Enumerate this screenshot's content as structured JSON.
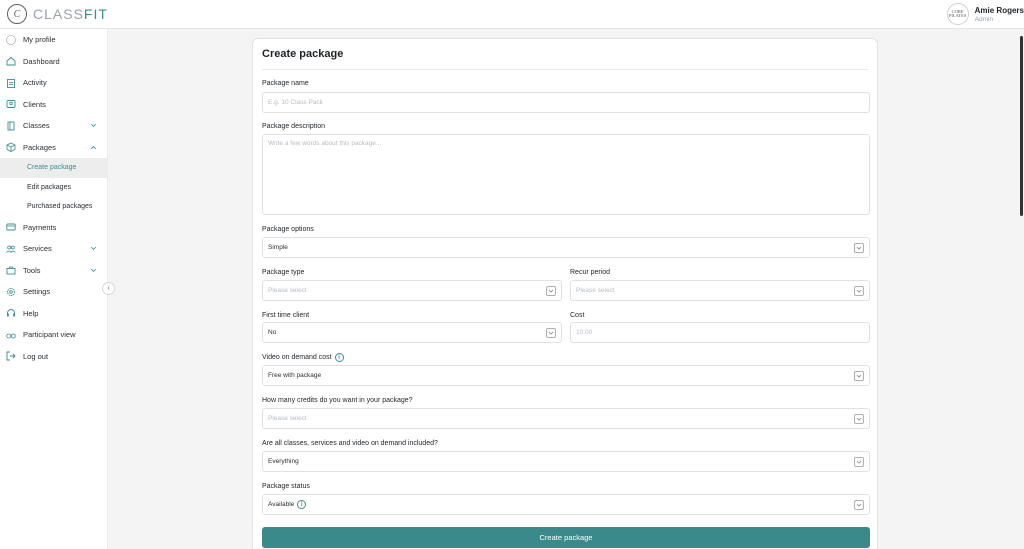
{
  "app": {
    "logo_mark": "C",
    "logo_a": "CLASS",
    "logo_b": "FIT",
    "accent": "#3c8e8f"
  },
  "user": {
    "avatar_line1": "CORE",
    "avatar_line2": "PILATES",
    "name": "Amie Rogers",
    "role": "Admin"
  },
  "sidebar": {
    "items": [
      {
        "label": "My profile",
        "icon": "avatar-icon"
      },
      {
        "label": "Dashboard",
        "icon": "home-icon"
      },
      {
        "label": "Activity",
        "icon": "clipboard-icon"
      },
      {
        "label": "Clients",
        "icon": "clients-icon"
      },
      {
        "label": "Classes",
        "icon": "book-icon"
      },
      {
        "label": "Packages",
        "icon": "box-icon"
      },
      {
        "label": "Payments",
        "icon": "card-icon"
      },
      {
        "label": "Services",
        "icon": "users-icon"
      },
      {
        "label": "Tools",
        "icon": "toolbox-icon"
      },
      {
        "label": "Settings",
        "icon": "gear-icon"
      },
      {
        "label": "Help",
        "icon": "headset-icon"
      },
      {
        "label": "Participant view",
        "icon": "glasses-icon"
      },
      {
        "label": "Log out",
        "icon": "logout-icon"
      }
    ],
    "packages_sub": [
      "Create package",
      "Edit packages",
      "Purchased packages"
    ],
    "collapse_glyph": "‹"
  },
  "form": {
    "title": "Create package",
    "package_name": {
      "label": "Package name",
      "placeholder": "E.g. 10 Class Pack"
    },
    "package_description": {
      "label": "Package description",
      "placeholder": "Write a few words about this package..."
    },
    "package_options": {
      "label": "Package options",
      "value": "Simple"
    },
    "package_type": {
      "label": "Package type",
      "value": "Please select"
    },
    "recur_period": {
      "label": "Recur period",
      "value": "Please select"
    },
    "first_time_client": {
      "label": "First time client",
      "value": "No"
    },
    "cost": {
      "label": "Cost",
      "placeholder": "10.00"
    },
    "vod_cost": {
      "label": "Video on demand cost",
      "value": "Free with package"
    },
    "credits": {
      "label": "How many credits do you want in your package?",
      "value": "Please select"
    },
    "included": {
      "label": "Are all classes, services and video on demand included?",
      "value": "Everything"
    },
    "status": {
      "label": "Package status",
      "value": "Available"
    },
    "info_glyph": "i",
    "submit_label": "Create package"
  }
}
